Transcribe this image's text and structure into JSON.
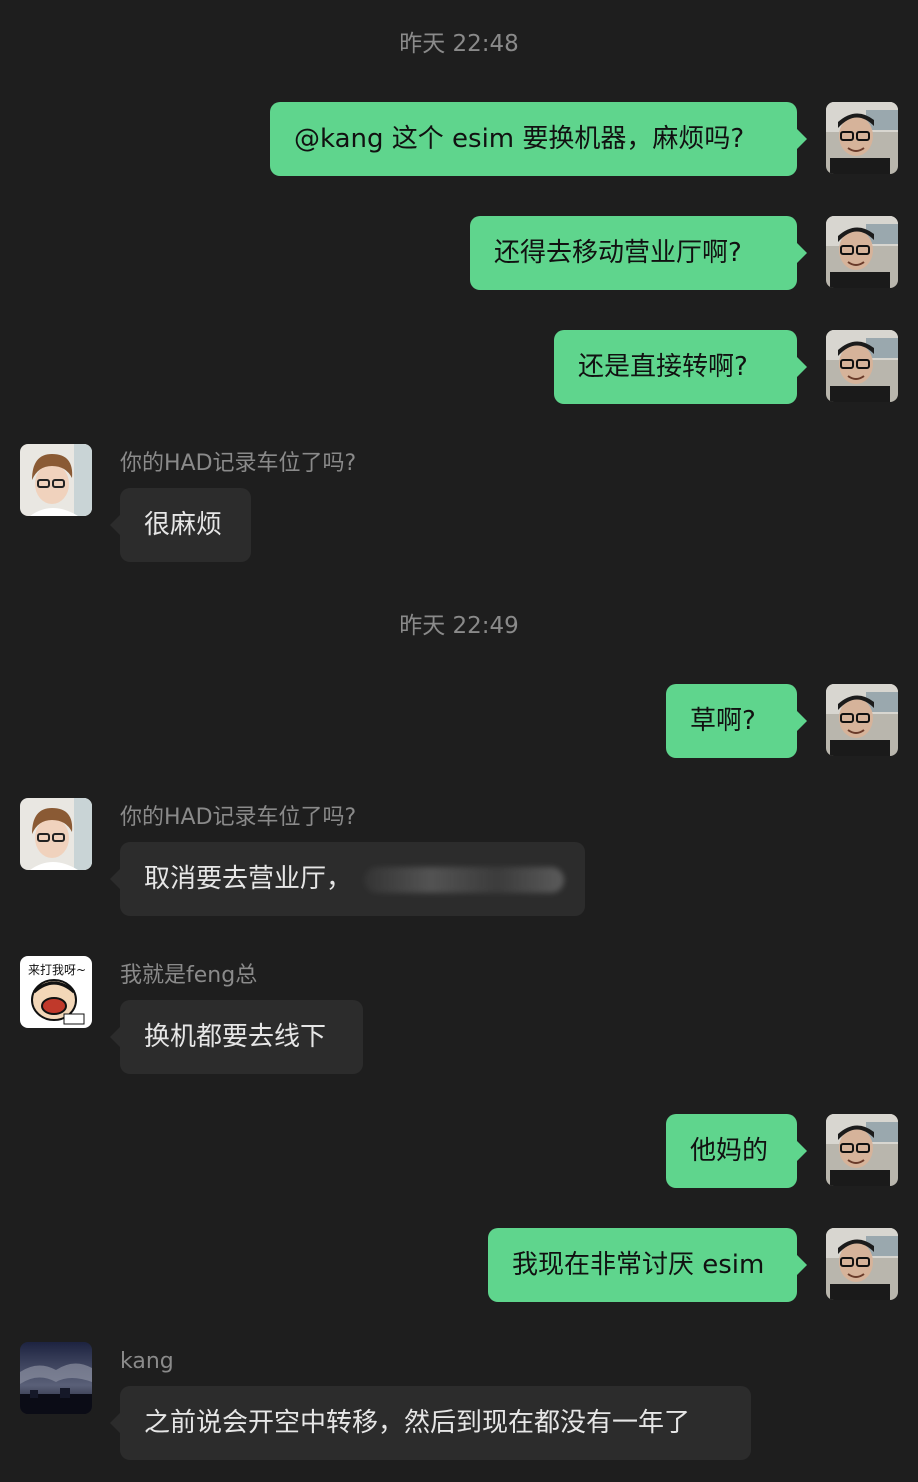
{
  "chat": {
    "timestamps": [
      "昨天 22:48",
      "昨天 22:49"
    ],
    "messages": [
      {
        "dir": "out",
        "text": "@kang 这个 esim 要换机器，麻烦吗?"
      },
      {
        "dir": "out",
        "text": "还得去移动营业厅啊?"
      },
      {
        "dir": "out",
        "text": "还是直接转啊?"
      },
      {
        "dir": "in",
        "sender": "你的HAD记录车位了吗?",
        "text": "很麻烦"
      },
      {
        "dir": "out",
        "text": "草啊?"
      },
      {
        "dir": "in",
        "sender": "你的HAD记录车位了吗?",
        "text": "取消要去营业厅，"
      },
      {
        "dir": "in",
        "sender": "我就是feng总",
        "text": "换机都要去线下"
      },
      {
        "dir": "out",
        "text": "他妈的"
      },
      {
        "dir": "out",
        "text": "我现在非常讨厌 esim"
      },
      {
        "dir": "in",
        "sender": "kang",
        "text": "之前说会开空中转移，然后到现在都没有一年了"
      }
    ]
  },
  "avatars": {
    "me": "user-avatar-glasses-man",
    "had": "contact-avatar-glasses-person",
    "feng": "contact-avatar-cartoon-sticker",
    "kang": "contact-avatar-cloudy-sky"
  },
  "colors": {
    "background": "#1e1e1e",
    "outgoing_bubble": "#5fd58d",
    "incoming_bubble": "#2c2c2c",
    "meta_text": "#8a8a8a"
  }
}
